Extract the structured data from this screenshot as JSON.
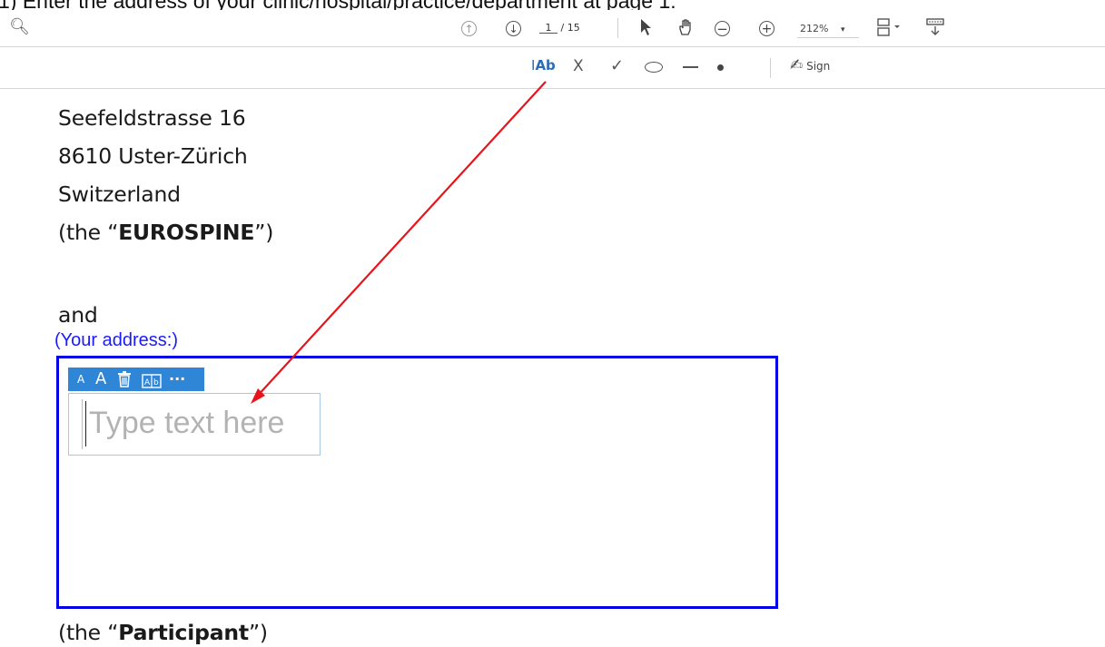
{
  "instruction": "1)  Enter the address of your clinic/hospital/practice/department at page 1:",
  "toolbar": {
    "page_current": "1",
    "page_total": "/ 15",
    "zoom": "212%",
    "zoom_caret": "▾"
  },
  "fill_sign": {
    "text_tool": "Ab",
    "cross": "X",
    "check": "✓",
    "sign_label": "Sign"
  },
  "document": {
    "partial_line": "",
    "street": "Seefeldstrasse 16",
    "city": "8610 Uster-Zürich",
    "country": "Switzerland",
    "eurospine_prefix": "(the “",
    "eurospine_bold": "EUROSPINE",
    "eurospine_suffix": "”)",
    "and": "and",
    "your_address": "(Your address:)",
    "participant_prefix": "(the “",
    "participant_bold": "Participant",
    "participant_suffix": "”)"
  },
  "text_field": {
    "placeholder": "Type text here",
    "format_toolbar": {
      "font_small": "A",
      "font_large": "A",
      "more": "···"
    }
  },
  "annotation": {
    "arrow_color": "#e8131b",
    "box_color": "#0000e6"
  }
}
